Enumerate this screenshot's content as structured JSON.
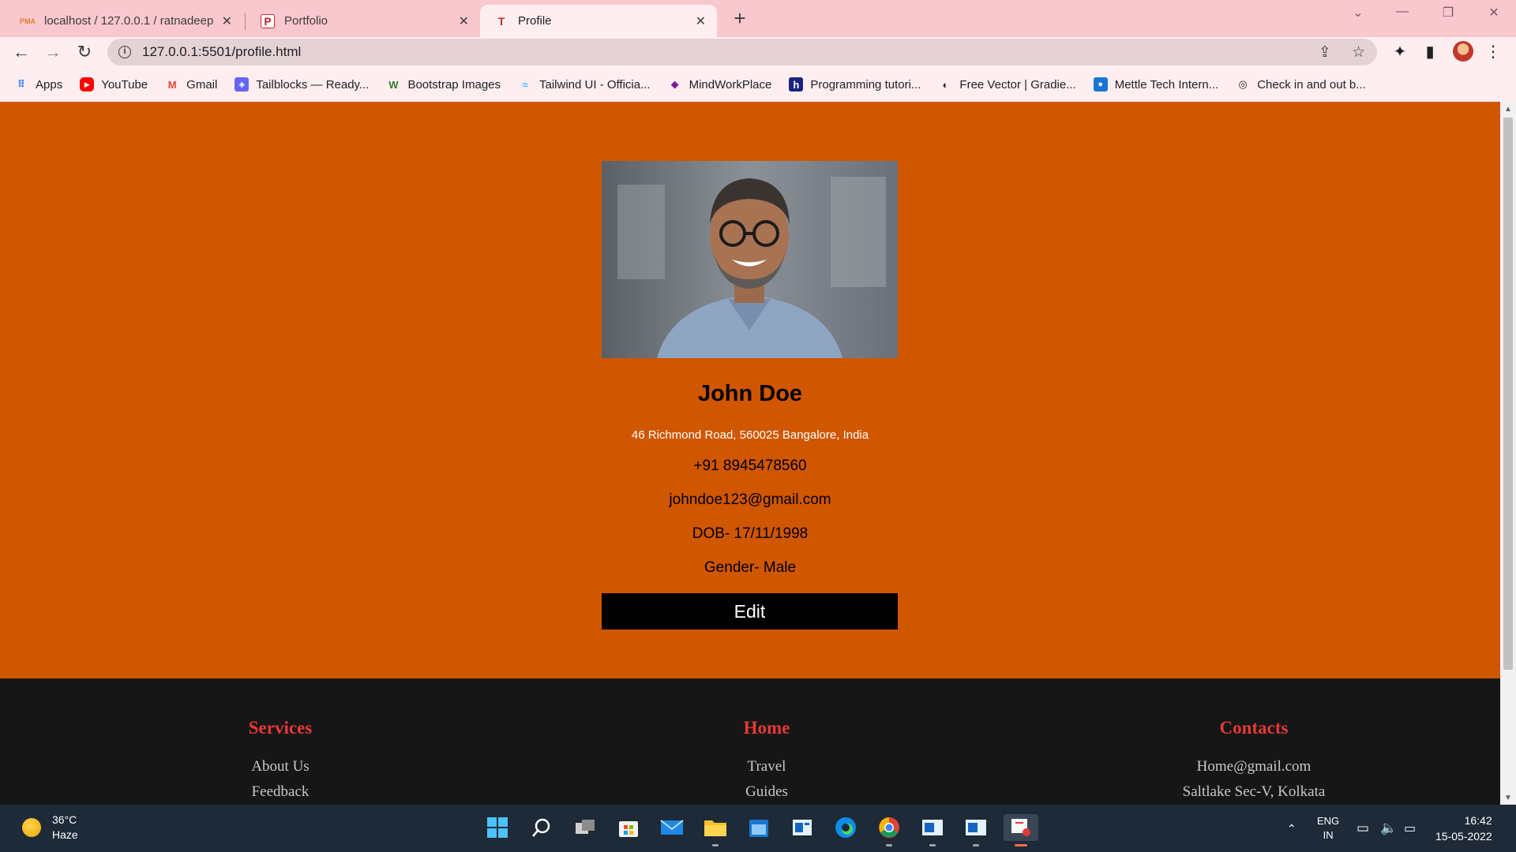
{
  "browser": {
    "tabs": [
      {
        "title": "localhost / 127.0.0.1 / ratnadeep",
        "active": false
      },
      {
        "title": "Portfolio",
        "active": false
      },
      {
        "title": "Profile",
        "active": true
      }
    ],
    "new_tab_glyph": "+",
    "address": "127.0.0.1:5501/profile.html",
    "bookmarks": [
      {
        "label": "Apps",
        "icon": "apps-grid-icon",
        "color": "#4285f4"
      },
      {
        "label": "YouTube",
        "icon": "youtube-icon",
        "color": "#ff0000"
      },
      {
        "label": "Gmail",
        "icon": "gmail-icon",
        "color": "#ea4335"
      },
      {
        "label": "Tailblocks — Ready...",
        "icon": "tailblocks-icon",
        "color": "#6366f1"
      },
      {
        "label": "Bootstrap Images",
        "icon": "bootstrap-images-icon",
        "color": "#2e7d32"
      },
      {
        "label": "Tailwind UI - Officia...",
        "icon": "tailwind-icon",
        "color": "#38bdf8"
      },
      {
        "label": "MindWorkPlace",
        "icon": "mindworkplace-icon",
        "color": "#7b1fa2"
      },
      {
        "label": "Programming tutori...",
        "icon": "programming-icon",
        "color": "#1a237e"
      },
      {
        "label": "Free Vector | Gradie...",
        "icon": "freevector-icon",
        "color": "#212121"
      },
      {
        "label": "Mettle Tech Intern...",
        "icon": "mettle-icon",
        "color": "#1976d2"
      },
      {
        "label": "Check in and out b...",
        "icon": "checkin-icon",
        "color": "#212121"
      }
    ]
  },
  "profile": {
    "name": "John Doe",
    "address": "46 Richmond Road, 560025 Bangalore, India",
    "phone": "+91 8945478560",
    "email": "johndoe123@gmail.com",
    "dob": "DOB- 17/11/1998",
    "gender": "Gender- Male",
    "edit_label": "Edit"
  },
  "footer": {
    "columns": [
      {
        "heading": "Services",
        "links": [
          "About Us",
          "Feedback"
        ]
      },
      {
        "heading": "Home",
        "links": [
          "Travel",
          "Guides"
        ]
      },
      {
        "heading": "Contacts",
        "links": [
          "Home@gmail.com",
          "Saltlake Sec-V, Kolkata"
        ]
      }
    ]
  },
  "taskbar": {
    "weather_temp": "36°C",
    "weather_desc": "Haze",
    "lang_top": "ENG",
    "lang_bottom": "IN",
    "time": "16:42",
    "date": "15-05-2022"
  },
  "colors": {
    "hero_bg": "#d05600",
    "footer_bg": "#161616",
    "footer_heading": "#e53935",
    "tab_strip": "#f9c8cf"
  }
}
